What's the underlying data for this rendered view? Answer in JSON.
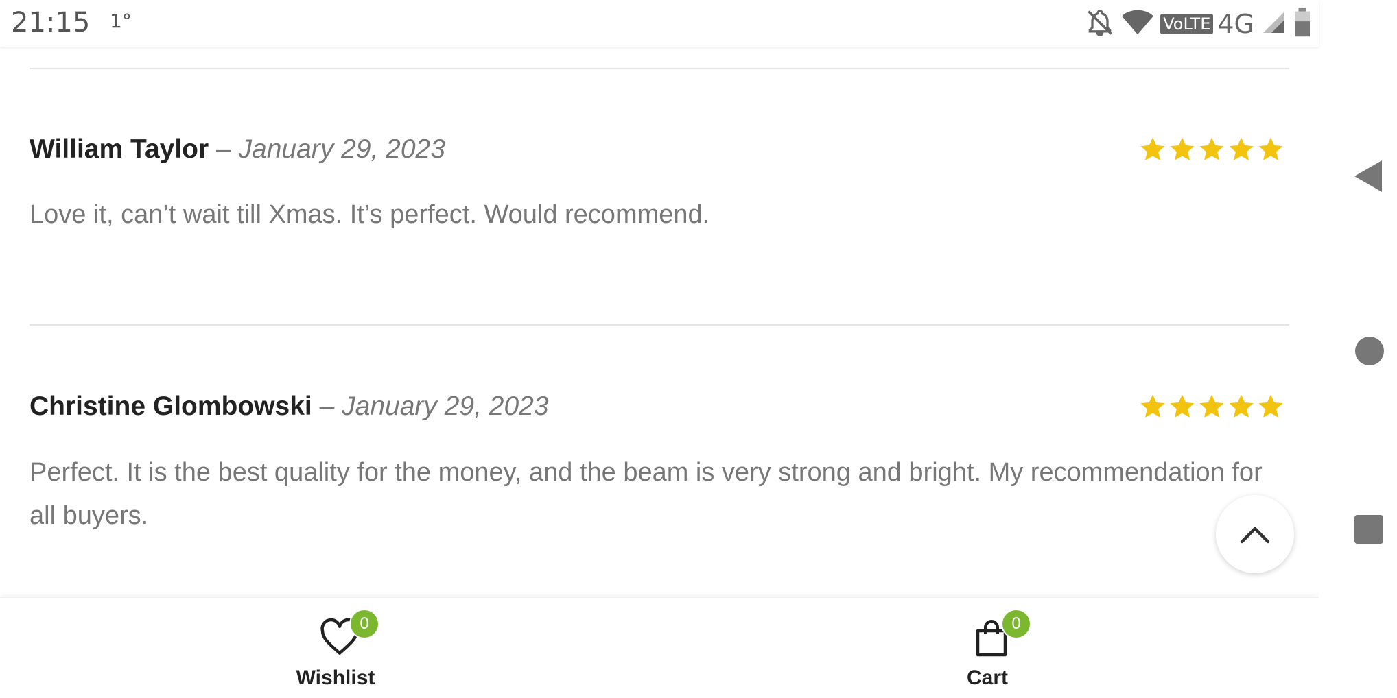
{
  "status_bar": {
    "time": "21:15",
    "temperature": "1°",
    "volte": "VoLTE",
    "network": "4G"
  },
  "reviews": [
    {
      "author": "William Taylor",
      "separator": "–",
      "date": "January 29, 2023",
      "rating": 5,
      "text": "Love it, can’t wait till Xmas. It’s perfect. Would recommend."
    },
    {
      "author": "Christine Glombowski",
      "separator": "–",
      "date": "January 29, 2023",
      "rating": 5,
      "text": "Perfect. It is the best quality for the money, and the beam is very strong and bright. My recommendation for all buyers."
    }
  ],
  "bottom_bar": {
    "wishlist": {
      "label": "Wishlist",
      "count": "0"
    },
    "cart": {
      "label": "Cart",
      "count": "0"
    }
  },
  "colors": {
    "star": "#f2c40f",
    "badge": "#7cb82f",
    "text_muted": "#777777",
    "text_dark": "#222222"
  },
  "icons": [
    "bell-off-icon",
    "wifi-icon",
    "signal-icon",
    "battery-icon",
    "back-icon",
    "home-icon",
    "recents-icon",
    "chevron-up-icon",
    "heart-icon",
    "shopping-bag-icon",
    "star-icon"
  ]
}
